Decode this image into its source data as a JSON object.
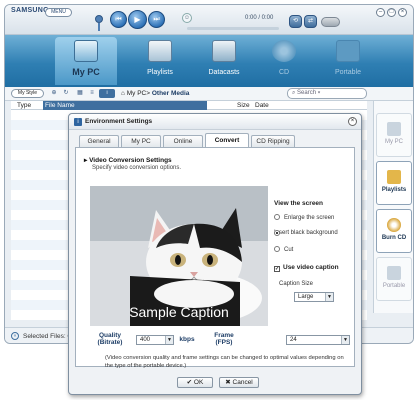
{
  "app": {
    "brand": "SAMSUNG",
    "menu_label": "MENU"
  },
  "player": {
    "time": "0:00 / 0:00"
  },
  "nav": {
    "tabs": [
      {
        "label": "My PC"
      },
      {
        "label": "Playlists"
      },
      {
        "label": "Datacasts"
      },
      {
        "label": "CD"
      },
      {
        "label": "Portable"
      }
    ],
    "active": "My PC"
  },
  "toolbar": {
    "my_style": "My Style",
    "breadcrumb_root": "My PC>",
    "breadcrumb_current": "Other Media",
    "search_placeholder": "Search"
  },
  "list": {
    "columns": [
      "Type",
      "File Name",
      "Size",
      "Date"
    ]
  },
  "status": {
    "text": "Selected Files: C"
  },
  "right_panel": {
    "items": [
      {
        "label": "My PC"
      },
      {
        "label": "Playlists"
      },
      {
        "label": "Burn CD"
      },
      {
        "label": "Portable"
      }
    ]
  },
  "dialog": {
    "title": "Environment Settings",
    "tabs": [
      "General",
      "My PC",
      "Online",
      "Convert",
      "CD Ripping"
    ],
    "active_tab": "Convert",
    "section_title": "Video Conversion Settings",
    "section_desc": "Specify video conversion options.",
    "preview_caption": "Sample Caption",
    "view_screen_label": "View the screen",
    "view_options": [
      "Enlarge the screen",
      "Insert black background",
      "Cut"
    ],
    "selected_view": "Insert black background",
    "use_caption_label": "Use video caption",
    "use_caption_checked": true,
    "caption_size_label": "Caption Size",
    "caption_size_value": "Large",
    "quality_label": "Quality",
    "quality_sub": "(Bitrate)",
    "quality_value": "400",
    "quality_unit": "kbps",
    "frame_label": "Frame",
    "frame_sub": "(FPS)",
    "frame_value": "24",
    "note": "(Video conversion quality and frame settings can be changed to optimal values depending on the type of the portable device.)",
    "ok_label": "OK",
    "cancel_label": "Cancel"
  },
  "colors": {
    "accent": "#2f7fb3",
    "title_blue": "#1d3d66"
  }
}
